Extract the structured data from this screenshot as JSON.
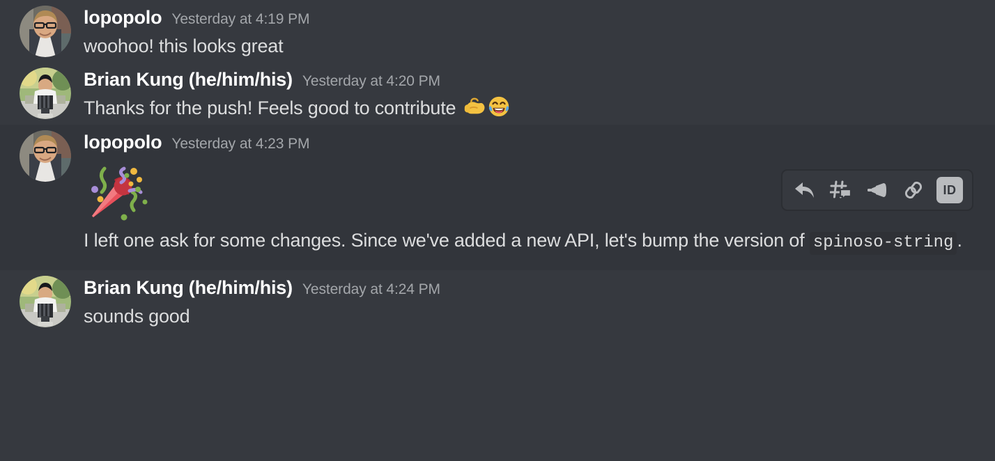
{
  "theme": {
    "background": "#36393f",
    "hover_background": "#32353b",
    "text_color": "#dcddde",
    "author_color": "#ffffff",
    "timestamp_color": "#a3a6aa",
    "code_background": "#2f3136",
    "icon_color": "#b9bbbe"
  },
  "messages": [
    {
      "author": "lopopolo",
      "timestamp": "Yesterday at 4:19 PM",
      "text": "woohoo! this looks great",
      "avatar": "avatar-lopopolo",
      "hovered": false
    },
    {
      "author": "Brian Kung (he/him/his)",
      "timestamp": "Yesterday at 4:20 PM",
      "text": "Thanks for the push! Feels good to contribute ",
      "emojis": [
        "flexed-biceps",
        "face-with-tears-of-joy"
      ],
      "avatar": "avatar-brian-kung",
      "hovered": false
    },
    {
      "author": "lopopolo",
      "timestamp": "Yesterday at 4:23 PM",
      "jumbo_emoji": "party-popper",
      "text_before_code": "I left one ask for some changes. Since we've added a new API, let's bump the version of ",
      "code": "spinoso-string",
      "text_after_code": ".",
      "avatar": "avatar-lopopolo",
      "hovered": true
    },
    {
      "author": "Brian Kung (he/him/his)",
      "timestamp": "Yesterday at 4:24 PM",
      "text": "sounds good",
      "avatar": "avatar-brian-kung",
      "hovered": false
    }
  ],
  "hover_toolbar": {
    "buttons": [
      {
        "name": "reply-icon",
        "label": "Reply"
      },
      {
        "name": "create-thread-icon",
        "label": "Create Thread"
      },
      {
        "name": "megaphone-icon",
        "label": "Announce"
      },
      {
        "name": "link-icon",
        "label": "Copy Message Link"
      },
      {
        "name": "copy-id-icon",
        "label": "ID"
      }
    ],
    "id_badge_text": "ID"
  }
}
